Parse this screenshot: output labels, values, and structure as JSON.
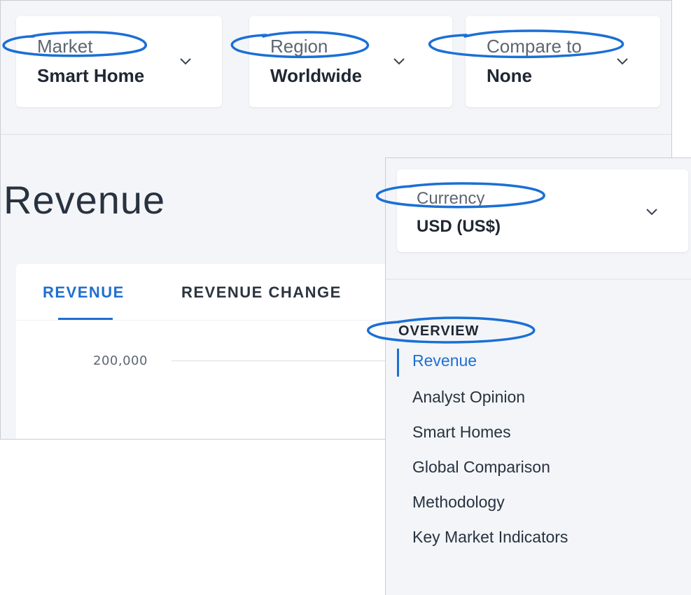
{
  "filters": [
    {
      "label": "Market",
      "value": "Smart Home"
    },
    {
      "label": "Region",
      "value": "Worldwide"
    },
    {
      "label": "Compare to",
      "value": "None"
    }
  ],
  "page_title": "Revenue",
  "tabs": [
    {
      "label": "REVENUE",
      "active": true
    },
    {
      "label": "REVENUE CHANGE",
      "active": false
    }
  ],
  "chart": {
    "y_tick": "200,000"
  },
  "currency": {
    "label": "Currency",
    "value": "USD (US$)"
  },
  "nav": {
    "heading": "OVERVIEW",
    "items": [
      {
        "label": "Revenue",
        "active": true
      },
      {
        "label": "Analyst Opinion",
        "active": false
      },
      {
        "label": "Smart Homes",
        "active": false
      },
      {
        "label": "Global Comparison",
        "active": false
      },
      {
        "label": "Methodology",
        "active": false
      },
      {
        "label": "Key Market Indicators",
        "active": false
      }
    ]
  },
  "colors": {
    "accent": "#1f6fd1",
    "annotation": "#1a6fd6",
    "background": "#f3f5f8"
  }
}
